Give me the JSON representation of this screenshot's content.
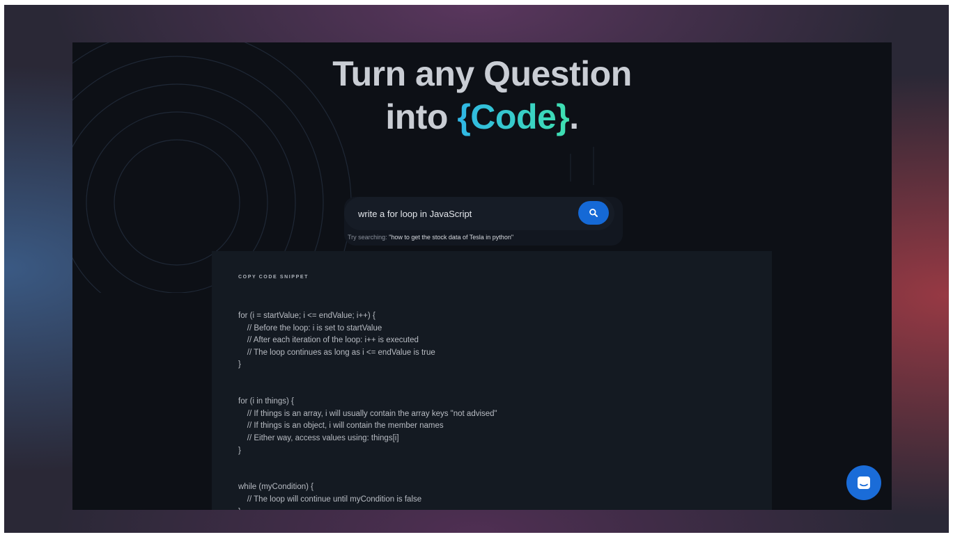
{
  "hero": {
    "line1": "Turn any Question",
    "line2_prefix": "into ",
    "line2_accent": "{Code}",
    "line2_suffix": "."
  },
  "search": {
    "value": "write a for loop in JavaScript",
    "icon": "search-icon",
    "hint_label": "Try searching: ",
    "hint_query": "\"how to get the stock data of Tesla in python\""
  },
  "snippet": {
    "title": "COPY CODE SNIPPET",
    "code": "for (i = startValue; i <= endValue; i++) {\n    // Before the loop: i is set to startValue\n    // After each iteration of the loop: i++ is executed\n    // The loop continues as long as i <= endValue is true\n}\n\n\nfor (i in things) {\n    // If things is an array, i will usually contain the array keys \"not advised\"\n    // If things is an object, i will contain the member names\n    // Either way, access values using: things[i]\n}\n\n\nwhile (myCondition) {\n    // The loop will continue until myCondition is false\n}"
  },
  "chat": {
    "icon": "chat-icon"
  },
  "colors": {
    "background": "#0d1016",
    "accent_start": "#2fb6e6",
    "accent_end": "#3fe0b0",
    "button_blue": "#1569d6"
  }
}
